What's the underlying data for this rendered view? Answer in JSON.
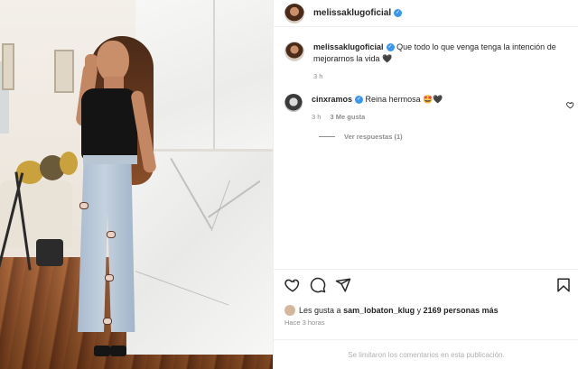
{
  "post": {
    "author": "melissaklugoficial",
    "caption_user": "melissaklugoficial",
    "caption": "Que todo lo que venga tenga la intención de mejorarnos la vida 🖤",
    "caption_time": "3 h"
  },
  "comments": [
    {
      "user": "cinxramos",
      "text": "Reina hermosa 🤩🖤",
      "time": "3 h",
      "likes": "3 Me gusta",
      "view_replies": "Ver respuestas (1)"
    }
  ],
  "likes": {
    "prefix": "Les gusta a",
    "first_user": "sam_lobaton_klug",
    "joiner": "y",
    "others": "2169 personas más"
  },
  "posted_ago": "Hace 3 horas",
  "footer_note": "Se limitaron los comentarios en esta publicación.",
  "icons": [
    "verified-badge",
    "heart-icon",
    "comment-icon",
    "share-icon",
    "bookmark-icon"
  ],
  "colors": {
    "verified": "#3897f0",
    "muted": "#8e8e8e",
    "border": "#efefef"
  }
}
